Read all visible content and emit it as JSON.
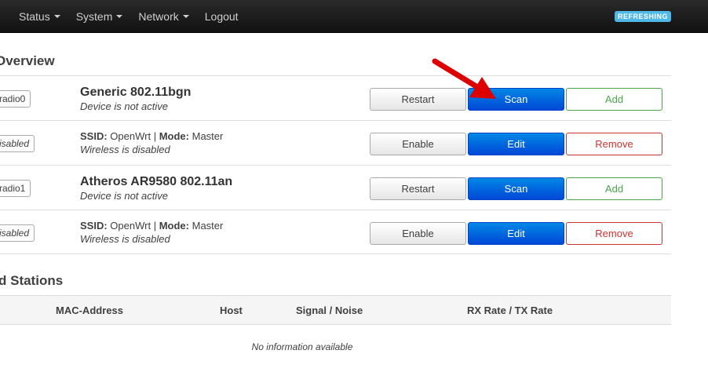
{
  "navbar": {
    "items": [
      {
        "label": "Status",
        "has_caret": true
      },
      {
        "label": "System",
        "has_caret": true
      },
      {
        "label": "Network",
        "has_caret": true
      },
      {
        "label": "Logout",
        "has_caret": false
      }
    ],
    "status_badge": "REFRESHING"
  },
  "overview": {
    "title": "Overview",
    "devices": [
      {
        "badge": "radio0",
        "name": "Generic 802.11bgn",
        "status": "Device is not active",
        "buttons": [
          "Restart",
          "Scan",
          "Add"
        ]
      },
      {
        "badge": "isabled",
        "ssid_label": "SSID:",
        "ssid": "OpenWrt",
        "separator": "|",
        "mode_label": "Mode:",
        "mode": "Master",
        "status": "Wireless is disabled",
        "buttons": [
          "Enable",
          "Edit",
          "Remove"
        ]
      },
      {
        "badge": "radio1",
        "name": "Atheros AR9580 802.11an",
        "status": "Device is not active",
        "buttons": [
          "Restart",
          "Scan",
          "Add"
        ]
      },
      {
        "badge": "isabled",
        "ssid_label": "SSID:",
        "ssid": "OpenWrt",
        "separator": "|",
        "mode_label": "Mode:",
        "mode": "Master",
        "status": "Wireless is disabled",
        "buttons": [
          "Enable",
          "Edit",
          "Remove"
        ]
      }
    ]
  },
  "stations": {
    "title": "d Stations",
    "columns": [
      "MAC-Address",
      "Host",
      "Signal / Noise",
      "RX Rate / TX Rate"
    ],
    "empty_text": "No information available"
  },
  "colors": {
    "navbar_bg": "#1b1b1b",
    "primary": "#0055dd",
    "add": "#4aa54a",
    "remove": "#cc3333",
    "status_badge": "#4fb8e6",
    "annotation_arrow": "#dd0000"
  },
  "icons": {
    "dropdown": "caret-down-icon",
    "annotation": "red-arrow-icon"
  }
}
